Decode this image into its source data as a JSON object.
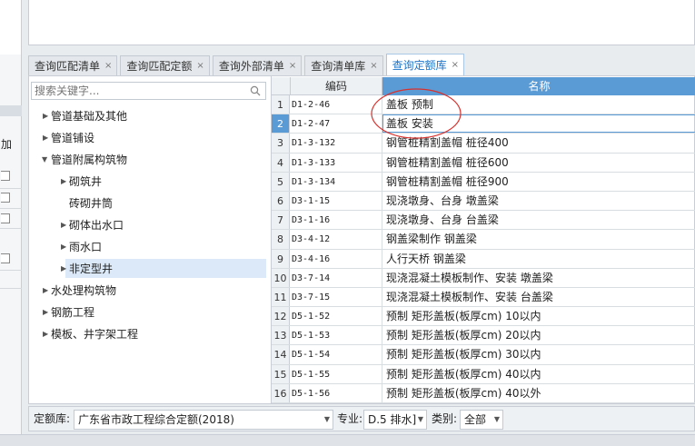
{
  "left_strip": {
    "label": "加"
  },
  "tabs": [
    {
      "label": "查询匹配清单",
      "active": false
    },
    {
      "label": "查询匹配定额",
      "active": false
    },
    {
      "label": "查询外部清单",
      "active": false
    },
    {
      "label": "查询清单库",
      "active": false
    },
    {
      "label": "查询定额库",
      "active": true
    }
  ],
  "tab_close": "×",
  "search": {
    "placeholder": "搜索关键字..."
  },
  "tree": [
    {
      "label": "管道基础及其他",
      "level": 0,
      "caret": "▶"
    },
    {
      "label": "管道铺设",
      "level": 0,
      "caret": "▶"
    },
    {
      "label": "管道附属构筑物",
      "level": 0,
      "caret": "▼"
    },
    {
      "label": "砌筑井",
      "level": 1,
      "caret": "▶"
    },
    {
      "label": "砖砌井筒",
      "level": 1,
      "caret": ""
    },
    {
      "label": "砌体出水口",
      "level": 1,
      "caret": "▶"
    },
    {
      "label": "雨水口",
      "level": 1,
      "caret": "▶"
    },
    {
      "label": "非定型井",
      "level": 1,
      "caret": "▶",
      "selected": true
    },
    {
      "label": "水处理构筑物",
      "level": 0,
      "caret": "▶"
    },
    {
      "label": "钢筋工程",
      "level": 0,
      "caret": "▶"
    },
    {
      "label": "模板、井字架工程",
      "level": 0,
      "caret": "▶"
    }
  ],
  "grid": {
    "headers": {
      "code": "编码",
      "name": "名称"
    },
    "rows": [
      {
        "num": "1",
        "code": "D1-2-46",
        "name": "盖板 预制"
      },
      {
        "num": "2",
        "code": "D1-2-47",
        "name": "盖板 安装",
        "current": true
      },
      {
        "num": "3",
        "code": "D1-3-132",
        "name": "钢管桩精割盖帽 桩径400"
      },
      {
        "num": "4",
        "code": "D1-3-133",
        "name": "钢管桩精割盖帽 桩径600"
      },
      {
        "num": "5",
        "code": "D1-3-134",
        "name": "钢管桩精割盖帽 桩径900"
      },
      {
        "num": "6",
        "code": "D3-1-15",
        "name": "现浇墩身、台身 墩盖梁"
      },
      {
        "num": "7",
        "code": "D3-1-16",
        "name": "现浇墩身、台身 台盖梁"
      },
      {
        "num": "8",
        "code": "D3-4-12",
        "name": "钢盖梁制作 钢盖梁"
      },
      {
        "num": "9",
        "code": "D3-4-16",
        "name": "人行天桥 钢盖梁"
      },
      {
        "num": "10",
        "code": "D3-7-14",
        "name": "现浇混凝土模板制作、安装 墩盖梁"
      },
      {
        "num": "11",
        "code": "D3-7-15",
        "name": "现浇混凝土模板制作、安装 台盖梁"
      },
      {
        "num": "12",
        "code": "D5-1-52",
        "name": "预制 矩形盖板(板厚cm) 10以内"
      },
      {
        "num": "13",
        "code": "D5-1-53",
        "name": "预制 矩形盖板(板厚cm) 20以内"
      },
      {
        "num": "14",
        "code": "D5-1-54",
        "name": "预制 矩形盖板(板厚cm) 30以内"
      },
      {
        "num": "15",
        "code": "D5-1-55",
        "name": "预制 矩形盖板(板厚cm) 40以内"
      },
      {
        "num": "16",
        "code": "D5-1-56",
        "name": "预制 矩形盖板(板厚cm) 40以外"
      }
    ]
  },
  "bottom": {
    "library_label": "定额库:",
    "library_value": "广东省市政工程综合定额(2018)",
    "major_label": "专业:",
    "major_value": "D.5 排水]",
    "category_label": "类别:",
    "category_value": "全部"
  },
  "colors": {
    "accent": "#5b9bd5",
    "tab_active_text": "#1b74c9",
    "annotation": "#d9302c",
    "selected_bg": "#dbe9f8"
  }
}
